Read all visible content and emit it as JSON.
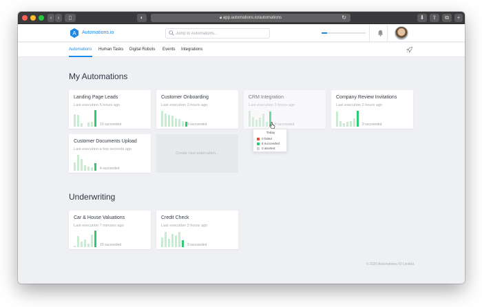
{
  "browser": {
    "url": "app.automations.io/automations",
    "back_label": "‹",
    "forward_label": "›",
    "sidebar_label": "▯",
    "shield_label": "◐"
  },
  "header": {
    "logo_text": "Automations.io",
    "logo_letter": "A",
    "search_placeholder": "Jump to Automations...",
    "progress": 0.12
  },
  "nav": {
    "items": [
      {
        "label": "Automations",
        "active": true
      },
      {
        "label": "Human Tasks"
      },
      {
        "label": "Digital Robots"
      },
      {
        "label": "Events"
      },
      {
        "label": "Integrations"
      }
    ]
  },
  "sections": [
    {
      "title": "My Automations",
      "cards": [
        {
          "title": "Landing Page Leads",
          "subtitle": "Last execution 5 hours ago",
          "succeeded": "10 succeeded",
          "bars": [
            0.75,
            0.7,
            0.2,
            0,
            0.25,
            0.3,
            1.0
          ]
        },
        {
          "title": "Customer Onboarding",
          "subtitle": "Last execution 3 hours ago",
          "succeeded": "9 succeeded",
          "bars": [
            0.95,
            0.8,
            0.7,
            0.65,
            0.5,
            0.45,
            0.35,
            0.3
          ]
        },
        {
          "title": "CRM Integration",
          "subtitle": "Last execution 2 hours ago",
          "succeeded": "8 succeeded",
          "bars": [
            0.95,
            0.6,
            0.4,
            0.55,
            0.8,
            0.3,
            0.9
          ]
        },
        {
          "title": "Company Review Invitations",
          "subtitle": "Last execution 2 hours ago",
          "succeeded": "9 succeeded",
          "bars": [
            0.9,
            0.35,
            0.2,
            0.3,
            0.35,
            0.5,
            0.95
          ]
        }
      ]
    },
    {
      "title": "Underwriting",
      "cards": [
        {
          "title": "Car & House Valuations",
          "subtitle": "Last execution 7 minutes ago",
          "succeeded": "10 succeeded",
          "bars": [
            0.1,
            0.65,
            0.35,
            0.45,
            0.2,
            0.75,
            1.0
          ]
        },
        {
          "title": "Credit Check",
          "subtitle": "Last execution 3 hours ago",
          "succeeded": "9 succeeded",
          "bars": [
            0.6,
            0.9,
            0.5,
            0.8,
            0.7,
            0.9,
            0.4
          ]
        }
      ]
    }
  ],
  "extra_card": {
    "title": "Customer Documents Upload",
    "subtitle": "Last execution a few seconds ago",
    "succeeded": "4 succeeded",
    "bars": [
      0.5,
      0.95,
      0.7,
      0.35,
      0.25,
      0.2,
      0.45
    ]
  },
  "new_automation_label": "Create new automation...",
  "tooltip": {
    "title": "Today",
    "rows": [
      {
        "label": "0 failed",
        "color": "#e74c3c"
      },
      {
        "label": "8 succeeded",
        "color": "#2ecc71"
      },
      {
        "label": "0 aborted",
        "color": "#cfd3d8"
      }
    ]
  },
  "footer": "© 2020 Automations IO Limited",
  "colors": {
    "accent": "#1e88e5",
    "success": "#2ecc71",
    "success_light": "#c9ebd2"
  }
}
